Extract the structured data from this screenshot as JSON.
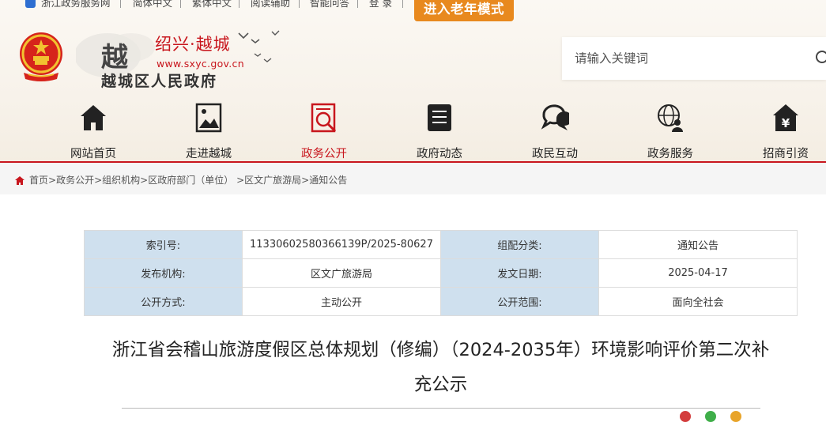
{
  "topbar": {
    "zjzwfw": "浙江政务服务网",
    "simplified": "简体中文",
    "traditional": "繁体中文",
    "reading": "阅读辅助",
    "smart_qa": "智能问答",
    "login": "登 录",
    "elder_mode": "进入老年模式"
  },
  "logo": {
    "char": "越",
    "title": "绍兴·越城",
    "url": "www.sxyc.gov.cn",
    "gov_name": "越城区人民政府"
  },
  "search": {
    "placeholder": "请输入关键词"
  },
  "nav": {
    "items": [
      {
        "label": "网站首页",
        "icon": "home-icon"
      },
      {
        "label": "走进越城",
        "icon": "picture-icon"
      },
      {
        "label": "政务公开",
        "icon": "document-search-icon"
      },
      {
        "label": "政府动态",
        "icon": "news-list-icon"
      },
      {
        "label": "政民互动",
        "icon": "chat-bubbles-icon"
      },
      {
        "label": "政务服务",
        "icon": "globe-user-icon"
      },
      {
        "label": "招商引资",
        "icon": "yuan-house-icon"
      }
    ],
    "active_index": 2
  },
  "breadcrumb": {
    "items": [
      "首页",
      "政务公开",
      "组织机构",
      "区政府部门（单位）",
      "区文广旅游局",
      "通知公告"
    ]
  },
  "info": {
    "index_no_label": "索引号:",
    "index_no": "11330602580366139P/2025-80627",
    "category_label": "组配分类:",
    "category": "通知公告",
    "publisher_label": "发布机构:",
    "publisher": "区文广旅游局",
    "date_label": "发文日期:",
    "date": "2025-04-17",
    "method_label": "公开方式:",
    "method": "主动公开",
    "scope_label": "公开范围:",
    "scope": "面向全社会"
  },
  "article": {
    "title": "浙江省会稽山旅游度假区总体规划（修编）（2024-2035年）环境影响评价第二次补充公示"
  },
  "colors": {
    "brand_red": "#c8161d",
    "elder_orange": "#e8891e",
    "table_key_bg": "#cfe0ee"
  }
}
